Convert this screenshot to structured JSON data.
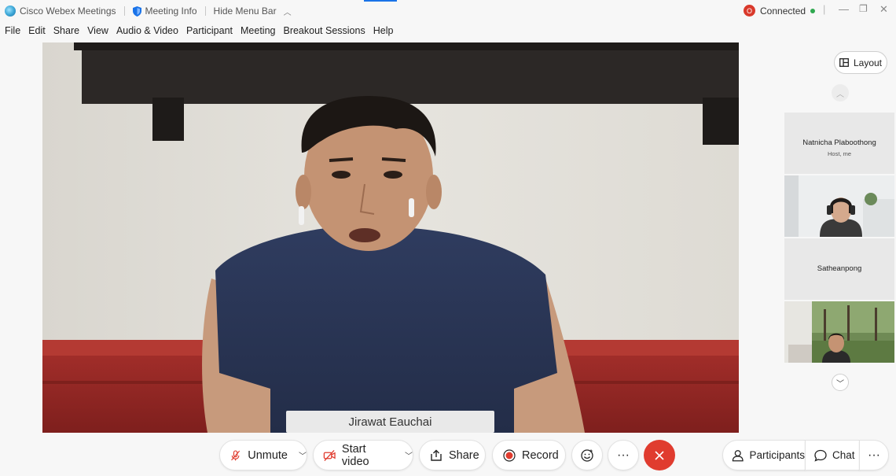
{
  "titlebar": {
    "app_name": "Cisco Webex Meetings",
    "meeting_info": "Meeting Info",
    "hide_menu": "Hide Menu Bar",
    "record_badge": "O",
    "status": "Connected"
  },
  "menu": [
    "File",
    "Edit",
    "Share",
    "View",
    "Audio & Video",
    "Participant",
    "Meeting",
    "Breakout Sessions",
    "Help"
  ],
  "main_video": {
    "speaker_name": "Jirawat Eauchai"
  },
  "side_panel": {
    "layout_label": "Layout",
    "tiles": [
      {
        "name": "Natnicha Plaboothong",
        "subtitle": "Host, me",
        "has_video": false
      },
      {
        "name": "",
        "subtitle": "",
        "has_video": true
      },
      {
        "name": "Satheanpong",
        "subtitle": "",
        "has_video": false
      },
      {
        "name": "",
        "subtitle": "",
        "has_video": true
      }
    ]
  },
  "toolbar": {
    "unmute": "Unmute",
    "start_video": "Start video",
    "share": "Share",
    "record": "Record",
    "more": "···",
    "participants": "Participants",
    "chat": "Chat",
    "overflow": "···"
  },
  "colors": {
    "end_call": "#e03c2f",
    "record_dot": "#e03c2f",
    "connected_dot": "#2fa84f",
    "accent": "#1a73e8"
  }
}
